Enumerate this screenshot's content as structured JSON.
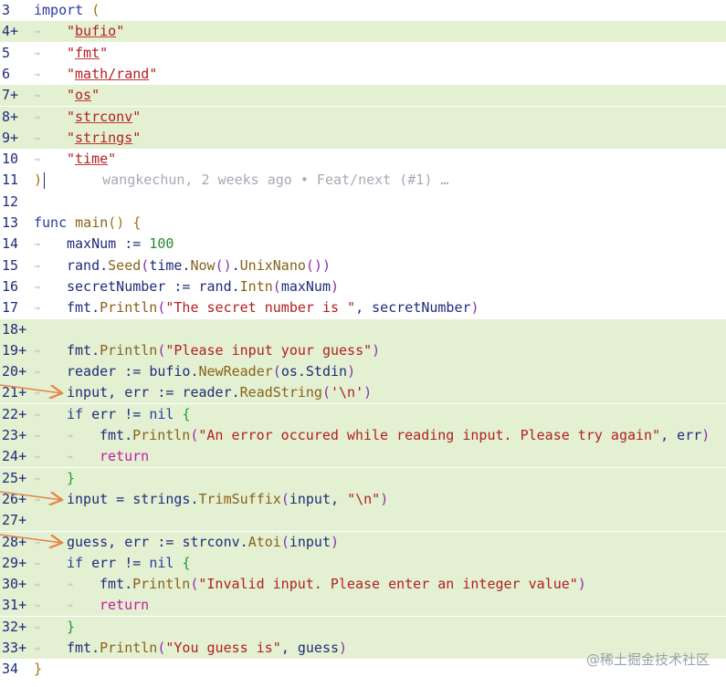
{
  "editor": {
    "lines": [
      {
        "num": "3",
        "mark": "",
        "added": false,
        "html": "<span class=\"kw\">import</span> <span class=\"brace-y\">(</span>"
      },
      {
        "num": "4",
        "mark": "+",
        "added": true,
        "html": "<span class=\"tab\">→</span><span class=\"str\">\"<span class=\"ul\">bufio</span>\"</span>"
      },
      {
        "num": "5",
        "mark": "",
        "added": false,
        "html": "<span class=\"tab\">→</span><span class=\"str\">\"<span class=\"ul\">fmt</span>\"</span>"
      },
      {
        "num": "6",
        "mark": "",
        "added": false,
        "html": "<span class=\"tab\">→</span><span class=\"str\">\"<span class=\"ul\">math/rand</span>\"</span>"
      },
      {
        "num": "7",
        "mark": "+",
        "added": true,
        "html": "<span class=\"tab\">→</span><span class=\"str\">\"<span class=\"ul\">os</span>\"</span>"
      },
      {
        "num": "8",
        "mark": "+",
        "added": true,
        "html": "<span class=\"tab\">→</span><span class=\"str\">\"<span class=\"ul\">strconv</span>\"</span>"
      },
      {
        "num": "9",
        "mark": "+",
        "added": true,
        "html": "<span class=\"tab\">→</span><span class=\"str\">\"<span class=\"ul\">strings</span>\"</span>"
      },
      {
        "num": "10",
        "mark": "",
        "added": false,
        "html": "<span class=\"tab\">→</span><span class=\"str\">\"<span class=\"ul\">time</span>\"</span>"
      },
      {
        "num": "11",
        "mark": "",
        "added": false,
        "html": "<span class=\"brace-y\">)</span><span class=\"cursor-mark\"></span><span class=\"blame\">   wangkechun, 2 weeks ago • Feat/next (#1) …</span>"
      },
      {
        "num": "12",
        "mark": "",
        "added": false,
        "html": ""
      },
      {
        "num": "13",
        "mark": "",
        "added": false,
        "html": "<span class=\"kw\">func</span> <span class=\"fn\">main</span><span class=\"brace-y\">()</span> <span class=\"brace-y\">{</span>"
      },
      {
        "num": "14",
        "mark": "",
        "added": false,
        "html": "<span class=\"tab\">→</span><span class=\"id\">maxNum</span> := <span class=\"num\">100</span>"
      },
      {
        "num": "15",
        "mark": "",
        "added": false,
        "html": "<span class=\"tab\">→</span><span class=\"id\">rand</span>.<span class=\"fn\">Seed</span><span class=\"brace-p\">(</span><span class=\"id\">time</span>.<span class=\"fn\">Now</span><span class=\"brace-p\">()</span>.<span class=\"fn\">UnixNano</span><span class=\"brace-p\">())</span>"
      },
      {
        "num": "16",
        "mark": "",
        "added": false,
        "html": "<span class=\"tab\">→</span><span class=\"id\">secretNumber</span> := <span class=\"id\">rand</span>.<span class=\"fn\">Intn</span><span class=\"brace-p\">(</span><span class=\"id\">maxNum</span><span class=\"brace-p\">)</span>"
      },
      {
        "num": "17",
        "mark": "",
        "added": false,
        "html": "<span class=\"tab\">→</span><span class=\"id\">fmt</span>.<span class=\"fn\">Println</span><span class=\"brace-p\">(</span><span class=\"str\">\"The secret number is \"</span>, <span class=\"id\">secretNumber</span><span class=\"brace-p\">)</span>"
      },
      {
        "num": "18",
        "mark": "+",
        "added": true,
        "html": ""
      },
      {
        "num": "19",
        "mark": "+",
        "added": true,
        "html": "<span class=\"tab\">→</span><span class=\"id\">fmt</span>.<span class=\"fn\">Println</span><span class=\"brace-p\">(</span><span class=\"str\">\"Please input your guess\"</span><span class=\"brace-p\">)</span>"
      },
      {
        "num": "20",
        "mark": "+",
        "added": true,
        "html": "<span class=\"tab\">→</span><span class=\"id\">reader</span> := <span class=\"id\">bufio</span>.<span class=\"fn\">NewReader</span><span class=\"brace-p\">(</span><span class=\"id\">os</span>.<span class=\"id\">Stdin</span><span class=\"brace-p\">)</span>"
      },
      {
        "num": "21",
        "mark": "+",
        "added": true,
        "html": "<span class=\"tab\">→</span><span class=\"id\">input</span>, <span class=\"id\">err</span> := <span class=\"id\">reader</span>.<span class=\"fn\">ReadString</span><span class=\"brace-p\">(</span><span class=\"str\">'\\n'</span><span class=\"brace-p\">)</span>"
      },
      {
        "num": "22",
        "mark": "+",
        "added": true,
        "html": "<span class=\"tab\">→</span><span class=\"kw\">if</span> <span class=\"id\">err</span> != <span class=\"kw\">nil</span> <span class=\"brace-g\">{</span>"
      },
      {
        "num": "23",
        "mark": "+",
        "added": true,
        "html": "<span class=\"tab\">→</span><span class=\"tab\">→</span><span class=\"id\">fmt</span>.<span class=\"fn\">Println</span><span class=\"brace-p\">(</span><span class=\"str\">\"An error occured while reading input. Please try again\"</span>, <span class=\"id\">err</span><span class=\"brace-p\">)</span>"
      },
      {
        "num": "24",
        "mark": "+",
        "added": true,
        "html": "<span class=\"tab\">→</span><span class=\"tab\">→</span><span class=\"ret\">return</span>"
      },
      {
        "num": "25",
        "mark": "+",
        "added": true,
        "html": "<span class=\"tab\">→</span><span class=\"brace-g\">}</span>"
      },
      {
        "num": "26",
        "mark": "+",
        "added": true,
        "html": "<span class=\"tab\">→</span><span class=\"id\">input</span> = <span class=\"id\">strings</span>.<span class=\"fn\">TrimSuffix</span><span class=\"brace-p\">(</span><span class=\"id\">input</span>, <span class=\"str\">\"\\n\"</span><span class=\"brace-p\">)</span>"
      },
      {
        "num": "27",
        "mark": "+",
        "added": true,
        "html": ""
      },
      {
        "num": "28",
        "mark": "+",
        "added": true,
        "html": "<span class=\"tab\">→</span><span class=\"id\">guess</span>, <span class=\"id\">err</span> := <span class=\"id\">strconv</span>.<span class=\"fn\">Atoi</span><span class=\"brace-p\">(</span><span class=\"id\">input</span><span class=\"brace-p\">)</span>"
      },
      {
        "num": "29",
        "mark": "+",
        "added": true,
        "html": "<span class=\"tab\">→</span><span class=\"kw\">if</span> <span class=\"id\">err</span> != <span class=\"kw\">nil</span> <span class=\"brace-g\">{</span>"
      },
      {
        "num": "30",
        "mark": "+",
        "added": true,
        "html": "<span class=\"tab\">→</span><span class=\"tab\">→</span><span class=\"id\">fmt</span>.<span class=\"fn\">Println</span><span class=\"brace-p\">(</span><span class=\"str\">\"Invalid input. Please enter an integer value\"</span><span class=\"brace-p\">)</span>"
      },
      {
        "num": "31",
        "mark": "+",
        "added": true,
        "html": "<span class=\"tab\">→</span><span class=\"tab\">→</span><span class=\"ret\">return</span>"
      },
      {
        "num": "32",
        "mark": "+",
        "added": true,
        "html": "<span class=\"tab\">→</span><span class=\"brace-g\">}</span>"
      },
      {
        "num": "33",
        "mark": "+",
        "added": true,
        "html": "<span class=\"tab\">→</span><span class=\"id\">fmt</span>.<span class=\"fn\">Println</span><span class=\"brace-p\">(</span><span class=\"str\">\"You guess is\"</span>, <span class=\"id\">guess</span><span class=\"brace-p\">)</span>"
      },
      {
        "num": "34",
        "mark": "",
        "added": false,
        "html": "<span class=\"brace-y\">}</span>"
      }
    ],
    "arrow_lines": [
      "21",
      "26",
      "28"
    ],
    "colors": {
      "added_bg": "#e4f0d2",
      "arrow": "#e8824a",
      "keyword": "#2a3ba0",
      "string": "#b12020",
      "function": "#87621a",
      "number": "#1f8a2c",
      "return": "#c31ba6"
    }
  },
  "watermark": {
    "text": "@稀土掘金技术社区"
  }
}
